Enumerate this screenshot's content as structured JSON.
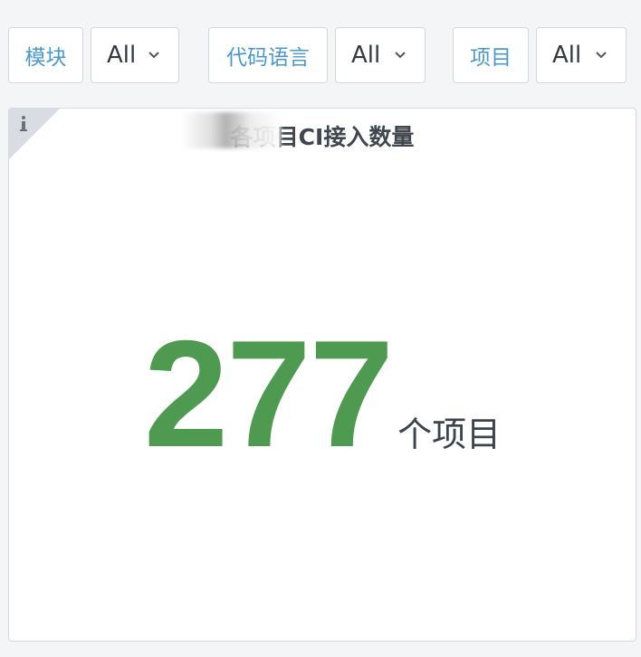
{
  "filters": [
    {
      "label": "模块",
      "value": "All"
    },
    {
      "label": "代码语言",
      "value": "All"
    },
    {
      "label": "项目",
      "value": "All"
    }
  ],
  "panel": {
    "info_icon": "info-icon",
    "title": "各项目CI接入数量",
    "value": "277",
    "unit": "个项目"
  },
  "colors": {
    "accent_label": "#4a98cf",
    "stat_green": "#4d9a50",
    "background": "#f4f5f7"
  }
}
